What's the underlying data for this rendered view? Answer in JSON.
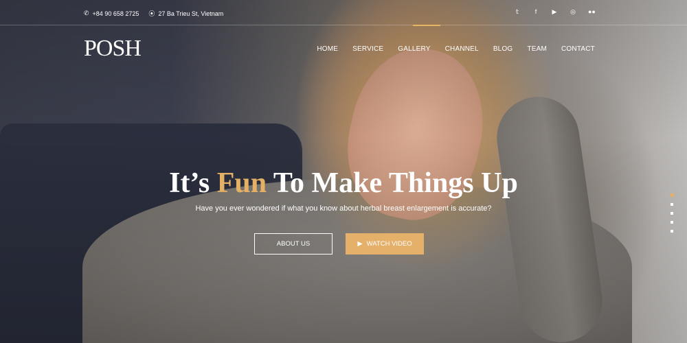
{
  "topbar": {
    "phone": "+84 90 658 2725",
    "address": "27 Ba Trieu St, Vietnam",
    "socials": [
      "twitter-icon",
      "facebook-icon",
      "youtube-icon",
      "instagram-icon",
      "flickr-icon"
    ]
  },
  "logo": "POSH",
  "nav": {
    "items": [
      "HOME",
      "SERVICE",
      "GALLERY",
      "CHANNEL",
      "BLOG",
      "TEAM",
      "CONTACT"
    ],
    "active": "GALLERY"
  },
  "hero": {
    "headline_part1": "It’s ",
    "headline_accent": "Fun",
    "headline_part2": " To Make Things Up",
    "subtitle": "Have you ever wondered if what you know about herbal breast enlargement is accurate?",
    "about_button": "ABOUT US",
    "video_button": "WATCH VIDEO"
  },
  "slider": {
    "slide_count": 5,
    "active_index": 0
  },
  "colors": {
    "accent": "#e4b06a"
  }
}
